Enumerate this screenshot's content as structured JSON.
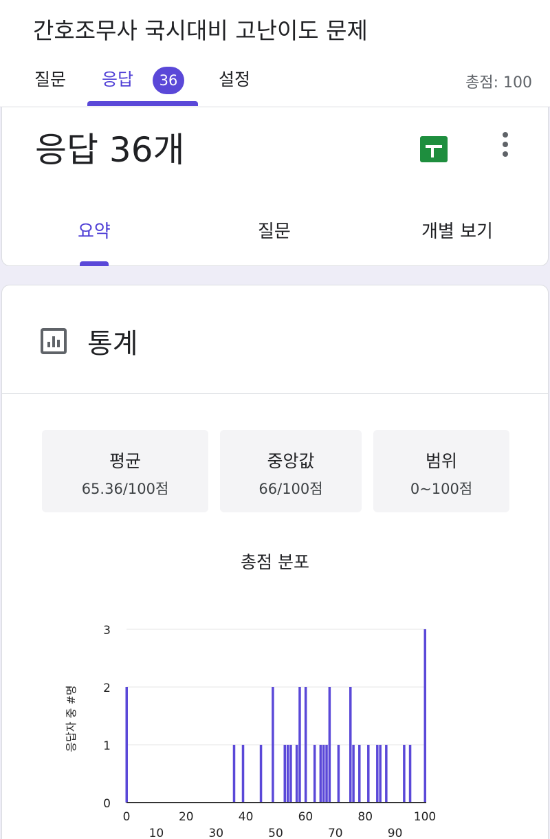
{
  "header": {
    "form_title": "간호조무사 국시대비 고난이도 문제",
    "tabs": [
      {
        "label": "질문"
      },
      {
        "label": "응답",
        "badge": "36"
      },
      {
        "label": "설정"
      }
    ],
    "total_points": "총점: 100"
  },
  "responses_card": {
    "title": "응답 36개",
    "subtabs": [
      "요약",
      "질문",
      "개별 보기"
    ]
  },
  "stats_card": {
    "title": "통계",
    "stats": [
      {
        "label": "평균",
        "value": "65.36/100점"
      },
      {
        "label": "중앙값",
        "value": "66/100점"
      },
      {
        "label": "범위",
        "value": "0~100점"
      }
    ],
    "chart_title": "총점 분포"
  },
  "colors": {
    "accent": "#5a48d8",
    "bar": "#5a48d8",
    "sheets_green": "#1e8e3e"
  },
  "icons": {
    "sheets": "google-sheets-icon",
    "more": "more-vert-icon",
    "stats": "bar-chart-icon"
  },
  "chart_data": {
    "type": "bar",
    "title": "총점 분포",
    "ylabel": "응답자 중 #명",
    "xlabel": "",
    "xlim": [
      0,
      100
    ],
    "ylim": [
      0,
      3
    ],
    "yticks": [
      0,
      1,
      2,
      3
    ],
    "xticks_upper": [
      0,
      20,
      40,
      60,
      80,
      100
    ],
    "xticks_lower": [
      10,
      30,
      50,
      70,
      90
    ],
    "grid": true,
    "legend": "none",
    "x": [
      0,
      36,
      39,
      45,
      49,
      53,
      54,
      55,
      57,
      58,
      60,
      63,
      65,
      66,
      67,
      68,
      71,
      75,
      76,
      78,
      81,
      84,
      85,
      87,
      93,
      95,
      100
    ],
    "values": [
      2,
      1,
      1,
      1,
      2,
      1,
      1,
      1,
      1,
      2,
      2,
      1,
      1,
      1,
      1,
      2,
      1,
      2,
      1,
      1,
      1,
      1,
      1,
      1,
      1,
      1,
      3
    ]
  }
}
